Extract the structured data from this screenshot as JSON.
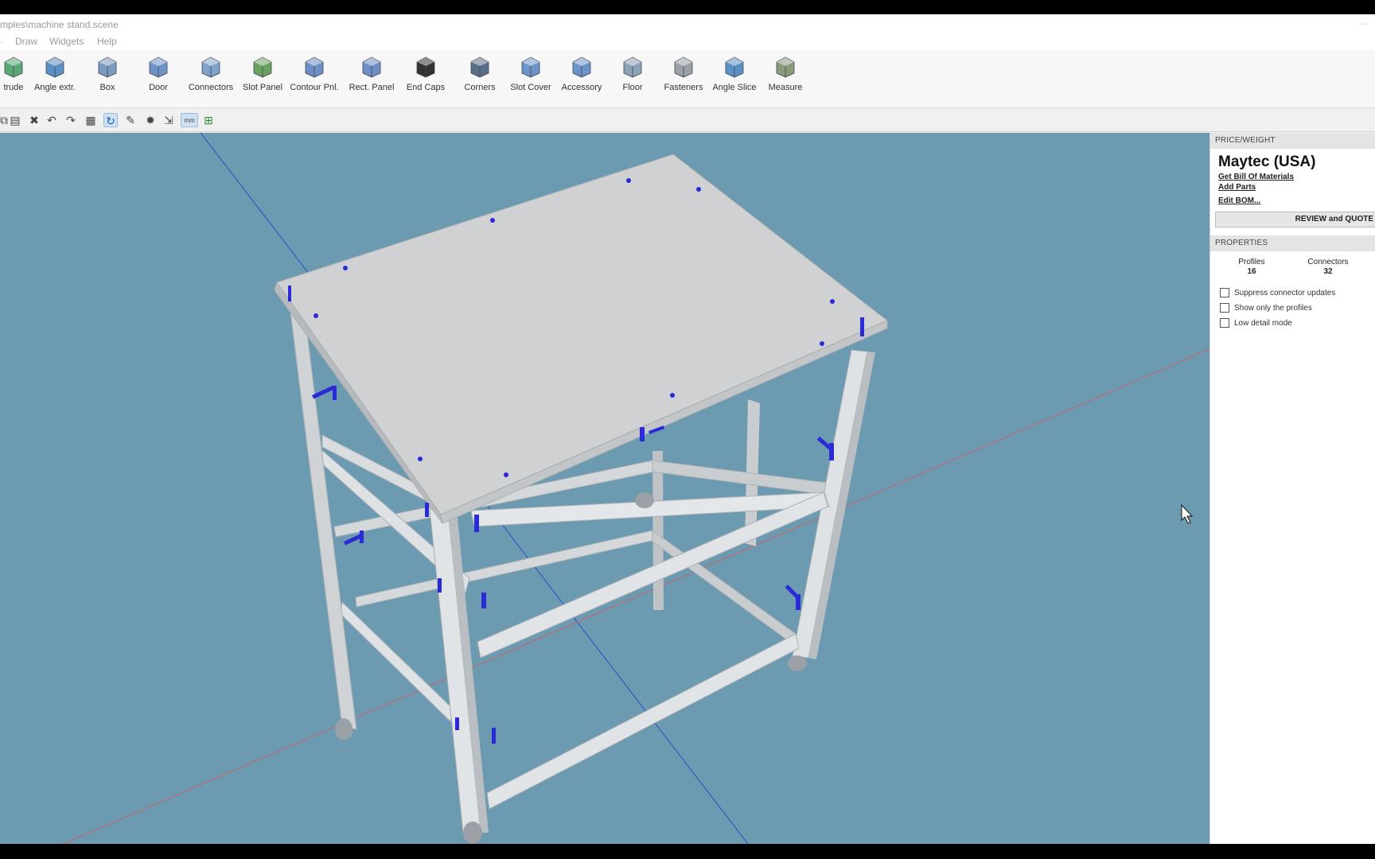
{
  "window": {
    "title": "mples\\machine stand.scene",
    "controls": "..."
  },
  "menu": [
    "Draw",
    "Widgets",
    "Help"
  ],
  "ribbon": [
    {
      "label": "trude",
      "icon": "extrude-icon"
    },
    {
      "label": "Angle extr.",
      "icon": "angle-extrude-icon"
    },
    {
      "label": "Box",
      "icon": "box-icon"
    },
    {
      "label": "Door",
      "icon": "door-icon"
    },
    {
      "label": "Connectors",
      "icon": "connectors-icon"
    },
    {
      "label": "Slot Panel",
      "icon": "slot-panel-icon"
    },
    {
      "label": "Contour Pnl.",
      "icon": "contour-panel-icon"
    },
    {
      "label": "Rect. Panel",
      "icon": "rect-panel-icon"
    },
    {
      "label": "End Caps",
      "icon": "end-caps-icon"
    },
    {
      "label": "Corners",
      "icon": "corners-icon"
    },
    {
      "label": "Slot Cover",
      "icon": "slot-cover-icon"
    },
    {
      "label": "Accessory",
      "icon": "accessory-icon"
    },
    {
      "label": "Floor",
      "icon": "floor-icon"
    },
    {
      "label": "Fasteners",
      "icon": "fasteners-icon"
    },
    {
      "label": "Angle Slice",
      "icon": "angle-slice-icon"
    },
    {
      "label": "Measure",
      "icon": "measure-icon"
    }
  ],
  "quickbar": {
    "icons": [
      "copy-icon",
      "paste-icon",
      "delete-icon",
      "undo-icon",
      "redo-icon",
      "grid-icon",
      "rotate-icon",
      "edit-icon",
      "settings-icon",
      "export-icon",
      "units-icon",
      "snap-icon"
    ],
    "units_label": "mm"
  },
  "colors": {
    "viewport_bg": "#6c9ab0",
    "profile": "#d7dadc",
    "connector": "#2a2ad6",
    "axis_red": "#c8646a",
    "axis_blue": "#2c4fc4"
  },
  "panel": {
    "price_header": "PRICE/WEIGHT",
    "vendor": "Maytec (USA)",
    "links": [
      "Get Bill Of Materials",
      "Add Parts",
      "Edit BOM..."
    ],
    "review_button": "REVIEW and QUOTE",
    "properties_header": "PROPERTIES",
    "stats": {
      "profiles_label": "Profiles",
      "profiles_value": "16",
      "connectors_label": "Connectors",
      "connectors_value": "32"
    },
    "options": [
      {
        "label": "Suppress connector updates",
        "checked": false
      },
      {
        "label": "Show only the profiles",
        "checked": false
      },
      {
        "label": "Low detail mode",
        "checked": false
      }
    ]
  }
}
